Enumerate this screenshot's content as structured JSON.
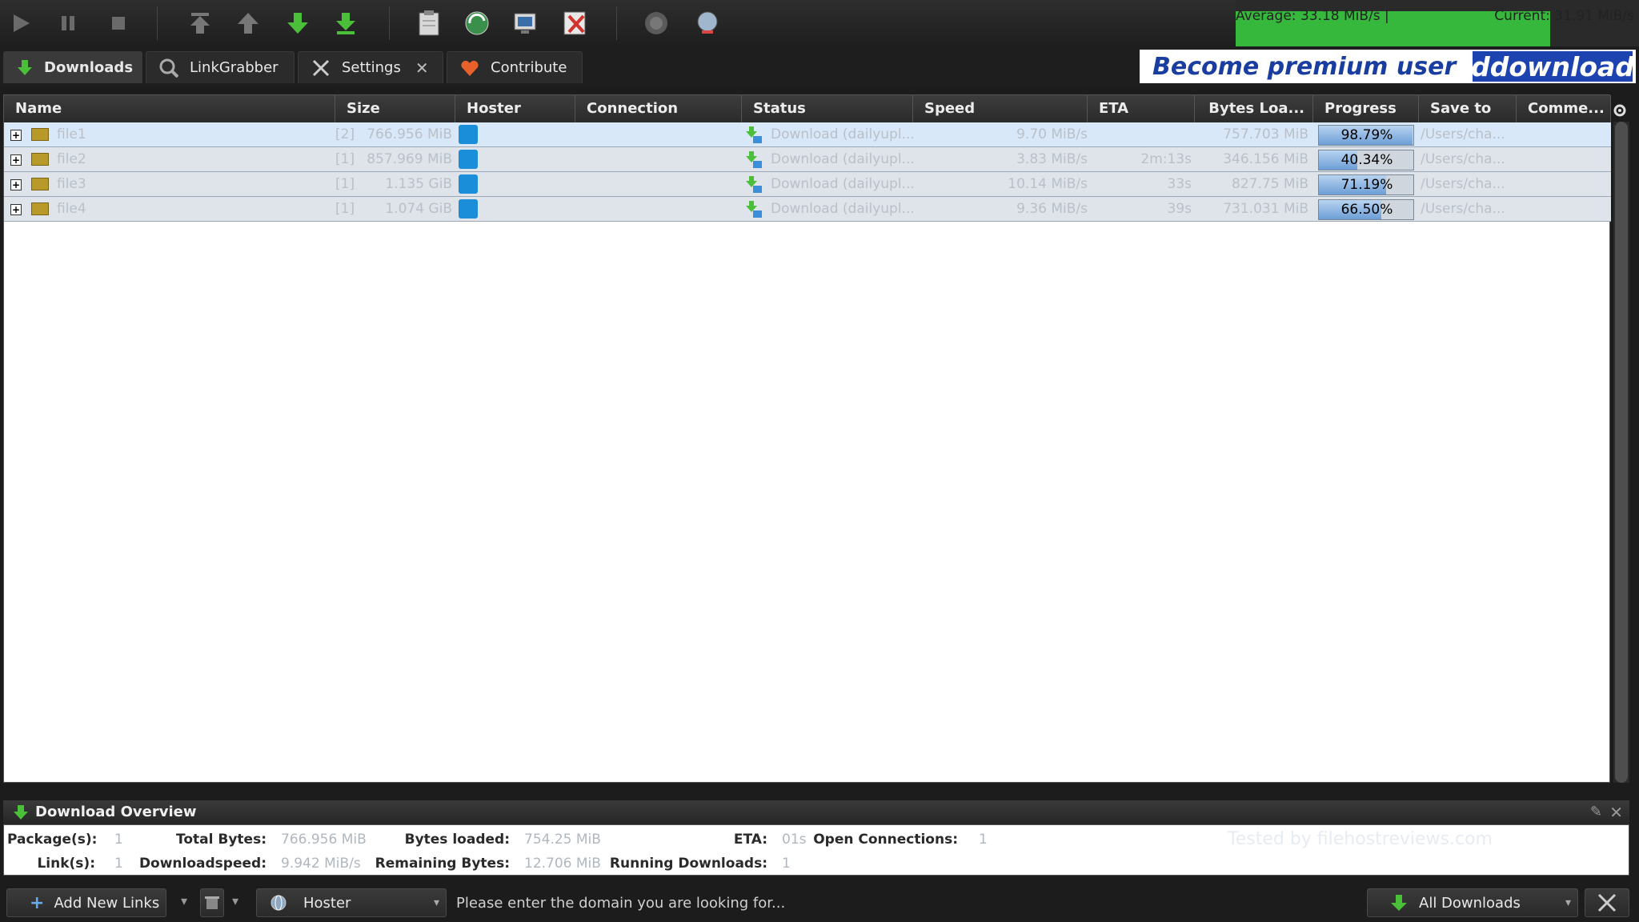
{
  "toolbar": {
    "speed_average": "Average: 33.18 MiB/s |",
    "speed_current": "Current: 31.91 MiB/s",
    "speed_bar_fraction": 0.78
  },
  "tabs": [
    {
      "label": "Downloads",
      "icon": "download-arrow-icon"
    },
    {
      "label": "LinkGrabber",
      "icon": "linkgrabber-icon"
    },
    {
      "label": "Settings",
      "icon": "wrench-icon"
    },
    {
      "label": "Contribute",
      "icon": "heart-icon"
    }
  ],
  "banner": {
    "text": "Become premium user",
    "logo": "ddownload"
  },
  "table": {
    "columns": [
      "Name",
      "Size",
      "Hoster",
      "Connection",
      "Status",
      "Speed",
      "ETA",
      "Bytes Loa...",
      "Progress",
      "Save to",
      "Comme..."
    ],
    "rows": [
      {
        "name": "file1",
        "count": "[2]",
        "size": "766.956 MiB",
        "status": "Download (dailyupl...",
        "speed": "9.70 MiB/s",
        "eta": "",
        "bytes": "757.703 MiB",
        "progress": "98.79%",
        "progress_value": 0.9879,
        "save_to": "/Users/cha..."
      },
      {
        "name": "file2",
        "count": "[1]",
        "size": "857.969 MiB",
        "status": "Download (dailyupl...",
        "speed": "3.83 MiB/s",
        "eta": "2m:13s",
        "bytes": "346.156 MiB",
        "progress": "40.34%",
        "progress_value": 0.4034,
        "save_to": "/Users/cha..."
      },
      {
        "name": "file3",
        "count": "[1]",
        "size": "1.135 GiB",
        "status": "Download (dailyupl...",
        "speed": "10.14 MiB/s",
        "eta": "33s",
        "bytes": "827.75 MiB",
        "progress": "71.19%",
        "progress_value": 0.7119,
        "save_to": "/Users/cha..."
      },
      {
        "name": "file4",
        "count": "[1]",
        "size": "1.074 GiB",
        "status": "Download (dailyupl...",
        "speed": "9.36 MiB/s",
        "eta": "39s",
        "bytes": "731.031 MiB",
        "progress": "66.50%",
        "progress_value": 0.665,
        "save_to": "/Users/cha..."
      }
    ]
  },
  "overview": {
    "title": "Download Overview",
    "packages_label": "Package(s):",
    "packages": "1",
    "links_label": "Link(s):",
    "links": "1",
    "total_bytes_label": "Total Bytes:",
    "total_bytes": "766.956 MiB",
    "downloadspeed_label": "Downloadspeed:",
    "downloadspeed": "9.942 MiB/s",
    "bytes_loaded_label": "Bytes loaded:",
    "bytes_loaded": "754.25 MiB",
    "remaining_label": "Remaining Bytes:",
    "remaining": "12.706 MiB",
    "eta_label": "ETA:",
    "eta": "01s",
    "running_label": "Running Downloads:",
    "running": "1",
    "open_conn_label": "Open Connections:",
    "open_conn": "1",
    "watermark": "Tested by filehostreviews.com"
  },
  "bottom": {
    "add_links": "Add New Links",
    "hoster_label": "Hoster",
    "search_placeholder": "Please enter the domain you are looking for...",
    "all_downloads": "All Downloads"
  },
  "colors": {
    "accent_green": "#36b83c",
    "selection": "#d8e8f8",
    "premium_blue": "#1d43b0"
  }
}
